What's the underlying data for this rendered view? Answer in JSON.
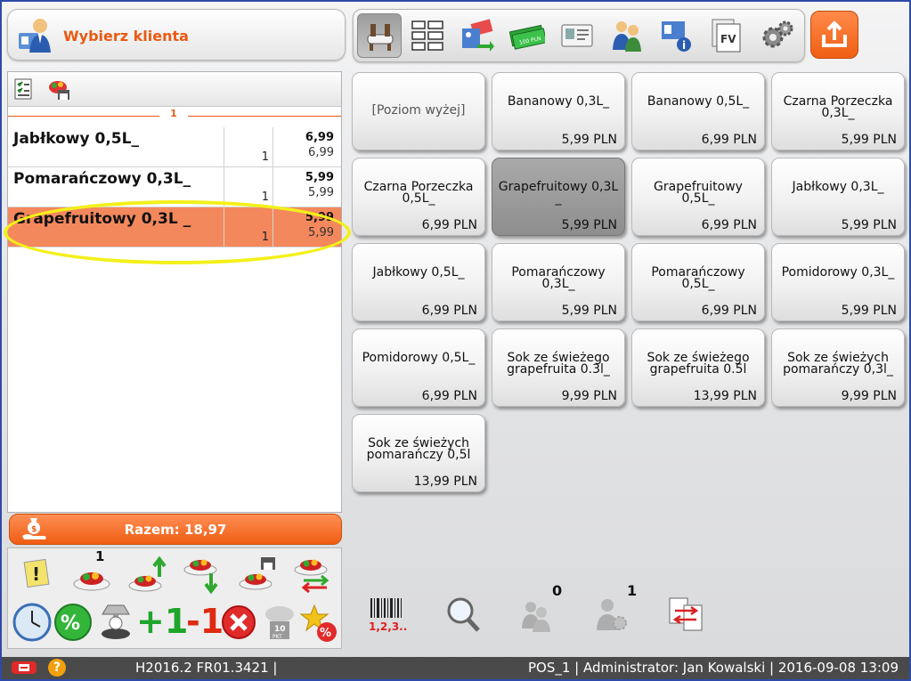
{
  "client": {
    "label": "Wybierz klienta"
  },
  "toolbar": {
    "icons": [
      "table-icon",
      "grid-list-icon",
      "discount-card-icon",
      "cash-icon",
      "id-card-icon",
      "clients-icon",
      "client-info-icon",
      "invoice-icon",
      "settings-icon"
    ],
    "invoice_label": "FV"
  },
  "order": {
    "group_number": "1",
    "rows": [
      {
        "name": "Jabłkowy 0,5L_",
        "qty": "1",
        "price": "6,99",
        "total": "6,99",
        "selected": false
      },
      {
        "name": "Pomarańczowy 0,3L_",
        "qty": "1",
        "price": "5,99",
        "total": "5,99",
        "selected": false
      },
      {
        "name": "Grapefruitowy 0,3L _",
        "qty": "1",
        "price": "5,99",
        "total": "5,99",
        "selected": true
      }
    ]
  },
  "total": {
    "label": "Razem: 18,97"
  },
  "actions": {
    "badge_one": "1",
    "plus_one": "+1",
    "minus_one": "-1",
    "points_label": "10",
    "points_unit": "PKT"
  },
  "products": [
    {
      "name": "[Poziom wyżej]",
      "price": "",
      "up": true
    },
    {
      "name": "Bananowy 0,3L_",
      "price": "5,99 PLN"
    },
    {
      "name": "Bananowy 0,5L_",
      "price": "6,99 PLN"
    },
    {
      "name": "Czarna Porzeczka 0,3L_",
      "price": "5,99 PLN"
    },
    {
      "name": "Czarna Porzeczka 0,5L_",
      "price": "6,99 PLN"
    },
    {
      "name": "Grapefruitowy 0,3L _",
      "price": "5,99 PLN",
      "active": true
    },
    {
      "name": "Grapefruitowy 0,5L_",
      "price": "6,99 PLN"
    },
    {
      "name": "Jabłkowy 0,3L_",
      "price": "5,99 PLN"
    },
    {
      "name": "Jabłkowy 0,5L_",
      "price": "6,99 PLN"
    },
    {
      "name": "Pomarańczowy 0,3L_",
      "price": "5,99 PLN"
    },
    {
      "name": "Pomarańczowy 0,5L_",
      "price": "6,99 PLN"
    },
    {
      "name": "Pomidorowy 0,3L_",
      "price": "5,99 PLN"
    },
    {
      "name": "Pomidorowy 0,5L_",
      "price": "6,99 PLN"
    },
    {
      "name": "Sok ze świeżego grapefruita 0.3l_",
      "price": "9,99 PLN"
    },
    {
      "name": "Sok ze świeżego grapefruita 0.5l",
      "price": "13,99 PLN"
    },
    {
      "name": "Sok ze świeżych pomarańczy 0,3l_",
      "price": "9,99 PLN"
    },
    {
      "name": "Sok ze świeżych pomarańczy 0,5l",
      "price": "13,99 PLN"
    }
  ],
  "tools": {
    "barcode_label": "1,2,3...",
    "waiters_count": "0",
    "clients_count": "1"
  },
  "status": {
    "version": "H2016.2 FR01.3421 |",
    "info": "POS_1 | Administrator: Jan Kowalski | 2016-09-08 13:09"
  },
  "colors": {
    "accent": "#ef5d12",
    "selected_row": "#f4885d",
    "highlight": "#f3f01a",
    "status_bg": "#4a4a4a"
  }
}
